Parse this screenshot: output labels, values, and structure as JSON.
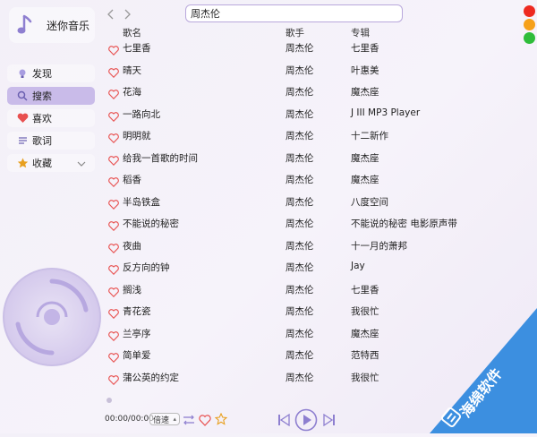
{
  "app": {
    "title": "迷你音乐"
  },
  "sidebar": {
    "items": [
      {
        "label": "发现",
        "icon": "bulb-icon"
      },
      {
        "label": "搜索",
        "icon": "search-icon",
        "active": true
      },
      {
        "label": "喜欢",
        "icon": "heart-icon"
      },
      {
        "label": "歌词",
        "icon": "lyrics-icon"
      },
      {
        "label": "收藏",
        "icon": "star-icon",
        "expandable": true
      }
    ]
  },
  "search": {
    "value": "周杰伦"
  },
  "table": {
    "headers": {
      "title": "歌名",
      "artist": "歌手",
      "album": "专辑"
    },
    "rows": [
      {
        "title": "七里香",
        "artist": "周杰伦",
        "album": "七里香"
      },
      {
        "title": "晴天",
        "artist": "周杰伦",
        "album": "叶惠美"
      },
      {
        "title": "花海",
        "artist": "周杰伦",
        "album": "魔杰座"
      },
      {
        "title": "一路向北",
        "artist": "周杰伦",
        "album": "J III MP3 Player"
      },
      {
        "title": "明明就",
        "artist": "周杰伦",
        "album": "十二新作"
      },
      {
        "title": "给我一首歌的时间",
        "artist": "周杰伦",
        "album": "魔杰座"
      },
      {
        "title": "稻香",
        "artist": "周杰伦",
        "album": "魔杰座"
      },
      {
        "title": "半岛铁盒",
        "artist": "周杰伦",
        "album": "八度空间"
      },
      {
        "title": "不能说的秘密",
        "artist": "周杰伦",
        "album": "不能说的秘密 电影原声带"
      },
      {
        "title": "夜曲",
        "artist": "周杰伦",
        "album": "十一月的萧邦"
      },
      {
        "title": "反方向的钟",
        "artist": "周杰伦",
        "album": "Jay"
      },
      {
        "title": "搁浅",
        "artist": "周杰伦",
        "album": "七里香"
      },
      {
        "title": "青花瓷",
        "artist": "周杰伦",
        "album": "我很忙"
      },
      {
        "title": "兰亭序",
        "artist": "周杰伦",
        "album": "魔杰座"
      },
      {
        "title": "简单爱",
        "artist": "周杰伦",
        "album": "范特西"
      },
      {
        "title": "蒲公英的约定",
        "artist": "周杰伦",
        "album": "我很忙"
      }
    ]
  },
  "player": {
    "time": "00:00/00:00",
    "speed_label": "倍速",
    "progress": 0
  },
  "window_buttons": [
    {
      "name": "close",
      "color": "#ee2a20"
    },
    {
      "name": "minimize",
      "color": "#f6a11a"
    },
    {
      "name": "maximize",
      "color": "#2fbd3a"
    }
  ],
  "watermark": {
    "text": "海绵软件",
    "color": "#3c8fe0"
  },
  "colors": {
    "accent": "#8e7fd0",
    "active_nav": "#c9bbe9",
    "heart": "#e8504f",
    "star": "#e8a020"
  }
}
